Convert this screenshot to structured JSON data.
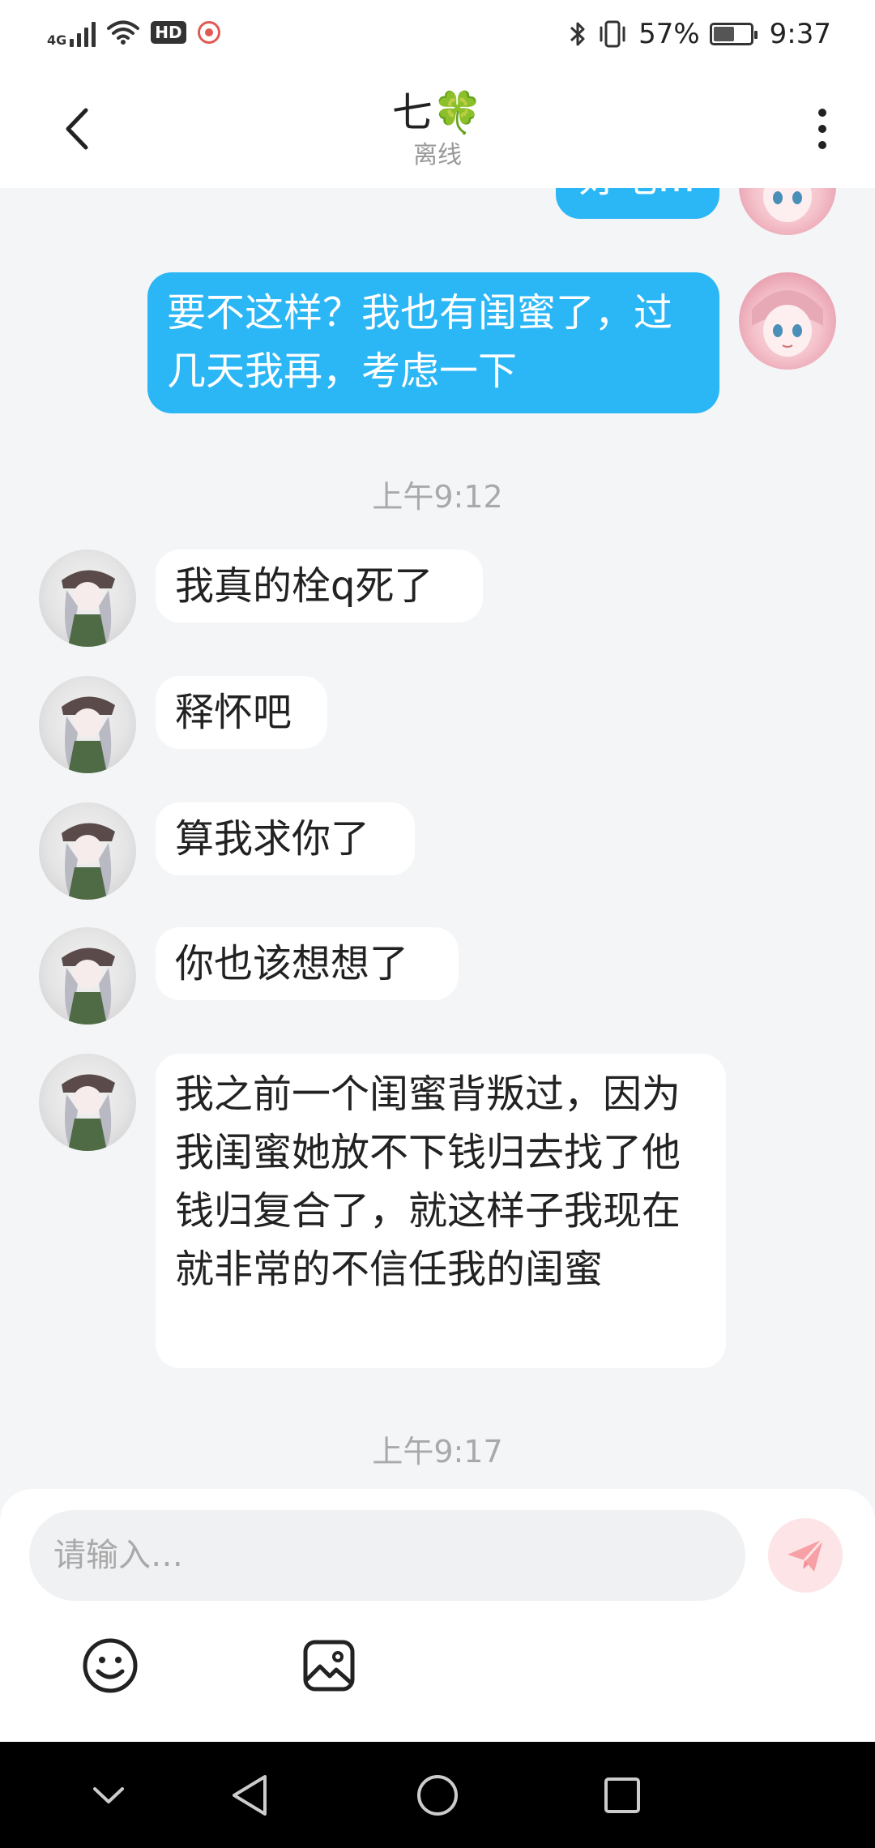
{
  "status_bar": {
    "network": "4G",
    "hd": "HD",
    "battery": "57%",
    "battery_level": 0.57,
    "time": "9:37",
    "icons": [
      "signal-icon",
      "wifi-icon",
      "hd-icon",
      "recording-icon",
      "bluetooth-icon",
      "vibrate-icon",
      "battery-icon"
    ]
  },
  "header": {
    "title": "七🍀",
    "subtitle": "离线"
  },
  "messages": [
    {
      "side": "out",
      "text": "好吧…"
    },
    {
      "side": "out",
      "text": "要不这样？我也有闺蜜了，过几天我再，考虑一下"
    },
    {
      "side": "in",
      "text": "我真的栓q死了"
    },
    {
      "side": "in",
      "text": "释怀吧"
    },
    {
      "side": "in",
      "text": "算我求你了"
    },
    {
      "side": "in",
      "text": "你也该想想了"
    },
    {
      "side": "in",
      "text": "我之前一个闺蜜背叛过，因为我闺蜜她放不下钱归去找了他钱归复合了，就这样子我现在就非常的不信任我的闺蜜"
    }
  ],
  "timestamps": [
    "上午9:12",
    "上午9:17"
  ],
  "input": {
    "placeholder": "请输入…",
    "value": ""
  },
  "toolbar": {
    "icons": [
      "emoji-icon",
      "image-icon"
    ]
  },
  "colors": {
    "outgoing_bubble": "#2bb6f5",
    "incoming_bubble": "#ffffff",
    "send_button": "#fde5e7",
    "send_icon": "#f7a0a5"
  }
}
